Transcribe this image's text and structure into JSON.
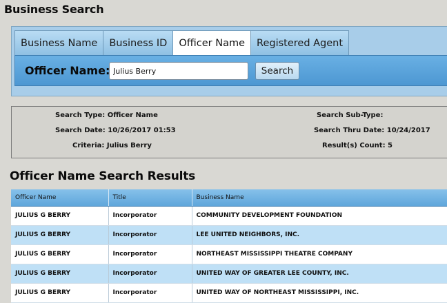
{
  "page": {
    "title": "Business Search"
  },
  "tabs": [
    {
      "label": "Business Name",
      "active": false
    },
    {
      "label": "Business ID",
      "active": false
    },
    {
      "label": "Officer Name",
      "active": true
    },
    {
      "label": "Registered Agent",
      "active": false
    }
  ],
  "search": {
    "label": "Officer Name:",
    "value": "Julius Berry",
    "button_label": "Search"
  },
  "summary": {
    "search_type": "Search Type: Officer Name",
    "search_date": "Search Date: 10/26/2017 01:53",
    "criteria": "Criteria: Julius Berry",
    "search_sub_type": "Search Sub-Type:",
    "search_thru_date": "Search Thru Date: 10/24/2017",
    "results_count": "Result(s) Count: 5"
  },
  "results": {
    "title": "Officer Name Search Results",
    "columns": [
      "Officer Name",
      "Title",
      "Business Name"
    ],
    "rows": [
      [
        "JULIUS G BERRY",
        "Incorporator",
        "COMMUNITY DEVELOPMENT FOUNDATION"
      ],
      [
        "JULIUS G BERRY",
        "Incorporator",
        "LEE UNITED NEIGHBORS, INC."
      ],
      [
        "JULIUS G BERRY",
        "Incorporator",
        "NORTHEAST MISSISSIPPI THEATRE COMPANY"
      ],
      [
        "JULIUS G BERRY",
        "Incorporator",
        "UNITED WAY OF GREATER LEE COUNTY, INC."
      ],
      [
        "JULIUS G BERRY",
        "Incorporator",
        "UNITED WAY OF NORTHEAST MISSISSIPPI, INC."
      ]
    ]
  },
  "colors": {
    "accent": "#4d97d2",
    "panel": "#a8cde9",
    "background": "#d9d8d3",
    "row_alt": "#bfe0f6"
  }
}
